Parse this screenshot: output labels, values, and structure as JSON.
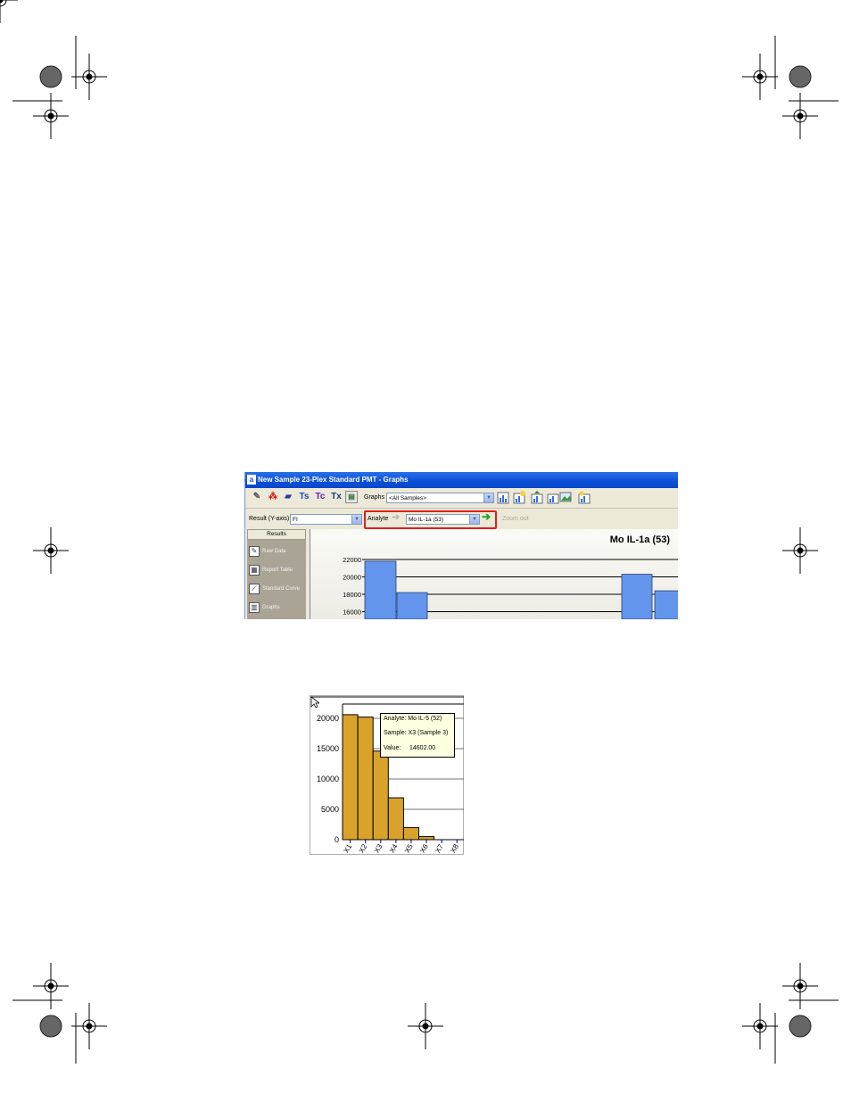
{
  "window": {
    "title": "New Sample 23-Plex Standard PMT - Graphs",
    "app_icon": "a"
  },
  "toolbar": {
    "icons": [
      "edit-icon",
      "analyte-icon",
      "plate-icon",
      "standards-icon",
      "controls-icon",
      "unknowns-icon",
      "report-icon"
    ],
    "icon_glyphs": [
      "✎",
      "⁂",
      "▰",
      "Ts",
      "Tc",
      "Tx",
      "▤"
    ],
    "graphs_label": "Graphs",
    "graphs_value": "<All Samples>",
    "action_icons": [
      "chart-icon",
      "chart-add-icon",
      "chart-save-icon",
      "chart-export-icon",
      "image-icon",
      "chart-options-icon"
    ]
  },
  "options": {
    "result_label": "Result (Y-axis)",
    "result_value": "FI",
    "analyte_label": "Analyte",
    "analyte_value": "Mo IL-1a (53)",
    "zoom_out_label": "Zoom out"
  },
  "results_panel": {
    "header": "Results",
    "items": [
      {
        "label": "Raw Data",
        "icon": "raw-data-icon",
        "glyph": "✎"
      },
      {
        "label": "Report Table",
        "icon": "report-table-icon",
        "glyph": "▦"
      },
      {
        "label": "Standard Curve",
        "icon": "standard-curve-icon",
        "glyph": "⟋"
      },
      {
        "label": "Graphs",
        "icon": "graphs-icon",
        "glyph": "▥"
      }
    ]
  },
  "chart_data": [
    {
      "type": "bar",
      "title": "Mo IL-1a (53)",
      "yticks": [
        "22000",
        "20000",
        "18000",
        "16000"
      ],
      "visible_bars": [
        21800,
        18200,
        20300,
        18400
      ],
      "bar_color": "#6495ed"
    },
    {
      "type": "bar",
      "categories": [
        "X1",
        "X2",
        "X3",
        "X4",
        "X5",
        "X6",
        "X7",
        "X8"
      ],
      "values": [
        20600,
        20200,
        14602,
        6900,
        2000,
        500,
        0,
        0
      ],
      "yticks": [
        "20000",
        "15000",
        "10000",
        "5000",
        "0"
      ],
      "ylim": [
        0,
        22000
      ],
      "bar_color": "#d9a22a",
      "tooltip": {
        "analyte": "Analyte: Mo IL-5 (52)",
        "sample": "Sample: X3 (Sample 3)",
        "value_label": "Value:",
        "value": "14602.00"
      }
    }
  ]
}
